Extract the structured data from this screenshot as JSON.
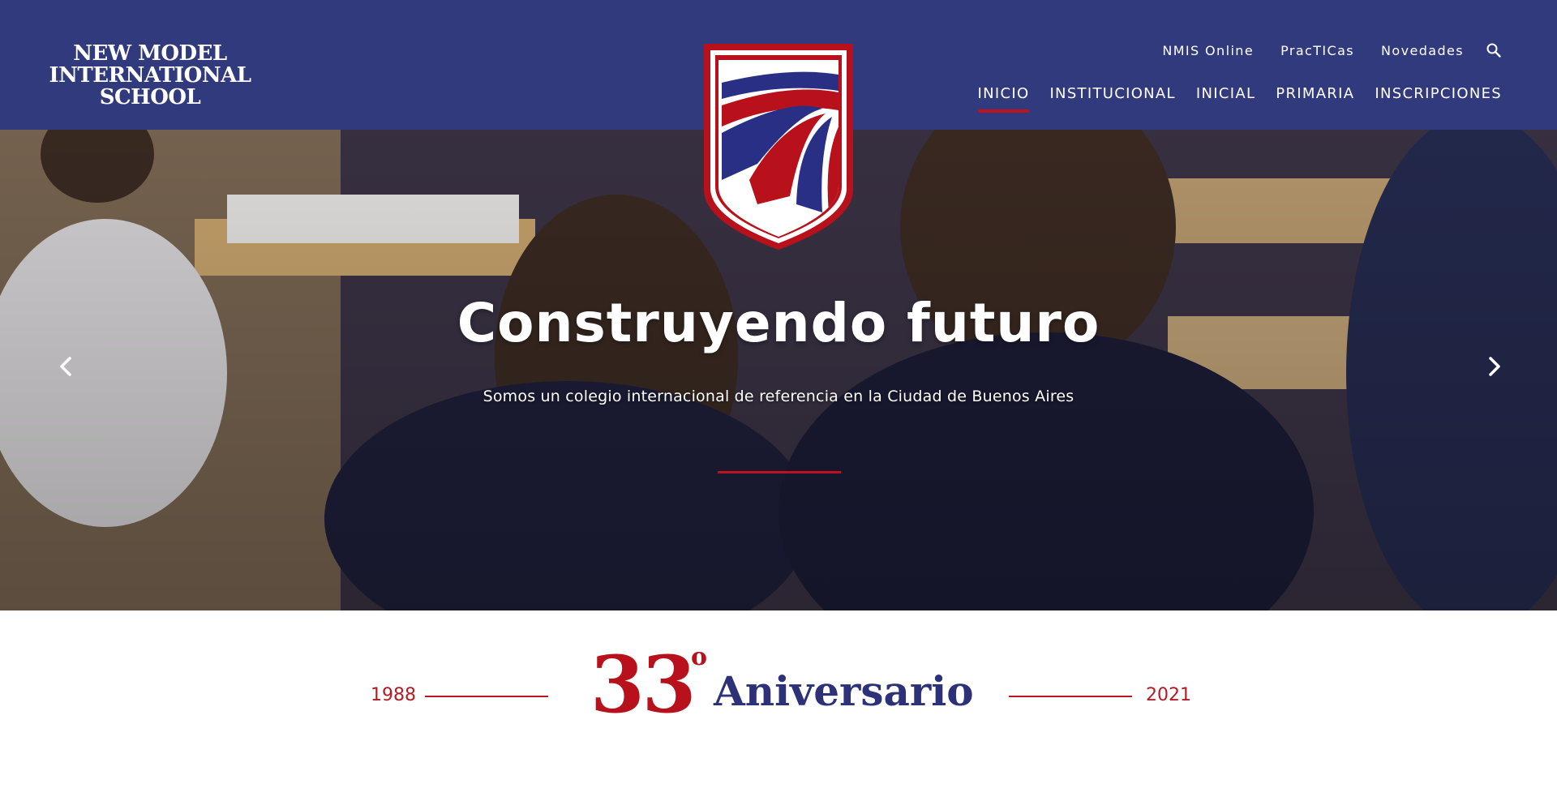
{
  "header": {
    "logo_lines": [
      "NEW MODEL",
      "INTERNATIONAL",
      "SCHOOL"
    ],
    "top_links": [
      "NMIS Online",
      "PracTICas",
      "Novedades"
    ],
    "search_icon": "search-icon",
    "nav": [
      "INICIO",
      "INSTITUCIONAL",
      "INICIAL",
      "PRIMARIA",
      "INSCRIPCIONES"
    ],
    "active_nav": "INICIO",
    "background_color": "#323a7e",
    "accent_color": "#c0121c"
  },
  "crest": {
    "icon": "school-crest-shield",
    "colors": [
      "#b8111b",
      "#2a2f86",
      "#ffffff"
    ]
  },
  "hero": {
    "title": "Construyendo futuro",
    "subtitle": "Somos un colegio internacional de referencia en la Ciudad de Buenos Aires",
    "prev_icon": "chevron-left-icon",
    "next_icon": "chevron-right-icon"
  },
  "anniversary": {
    "year_start": "1988",
    "year_end": "2021",
    "number": "33",
    "ordinal": "o",
    "word": "Aniversario",
    "number_color": "#b8111b",
    "word_color": "#2d3278"
  }
}
